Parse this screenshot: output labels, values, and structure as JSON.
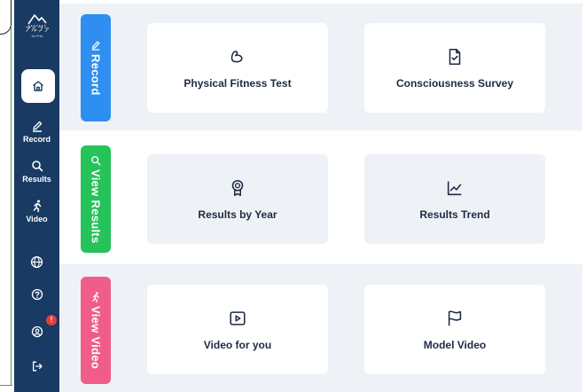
{
  "brand": {
    "logo_text": "アルファ",
    "logo_sub": "ALPHA"
  },
  "sidebar": {
    "items": [
      {
        "label": "",
        "icon": "home-icon"
      },
      {
        "label": "Record",
        "icon": "pencil-icon"
      },
      {
        "label": "Results",
        "icon": "search-icon"
      },
      {
        "label": "Video",
        "icon": "runner-icon"
      },
      {
        "label": "",
        "icon": "globe-icon"
      },
      {
        "label": "",
        "icon": "help-icon"
      },
      {
        "label": "",
        "icon": "account-icon",
        "badge": "!"
      },
      {
        "label": "",
        "icon": "logout-icon"
      }
    ]
  },
  "sections": [
    {
      "tab": "Record",
      "tab_color": "#2f8ff1",
      "tab_icon": "pencil-icon",
      "cards": [
        {
          "label": "Physical Fitness Test",
          "icon": "bicep-icon"
        },
        {
          "label": "Consciousness Survey",
          "icon": "document-check-icon"
        }
      ]
    },
    {
      "tab": "View Results",
      "tab_color": "#26c25a",
      "tab_icon": "search-icon",
      "cards": [
        {
          "label": "Results by Year",
          "icon": "medal-icon"
        },
        {
          "label": "Results Trend",
          "icon": "trend-chart-icon"
        }
      ]
    },
    {
      "tab": "View Video",
      "tab_color": "#f05d8a",
      "tab_icon": "runner-icon",
      "cards": [
        {
          "label": "Video for you",
          "icon": "play-icon"
        },
        {
          "label": "Model Video",
          "icon": "flag-icon"
        }
      ]
    }
  ],
  "colors": {
    "sidebar": "#183a63",
    "text_dark": "#1e2a44",
    "row_gray": "#eef2f6",
    "badge": "#e0413b"
  }
}
